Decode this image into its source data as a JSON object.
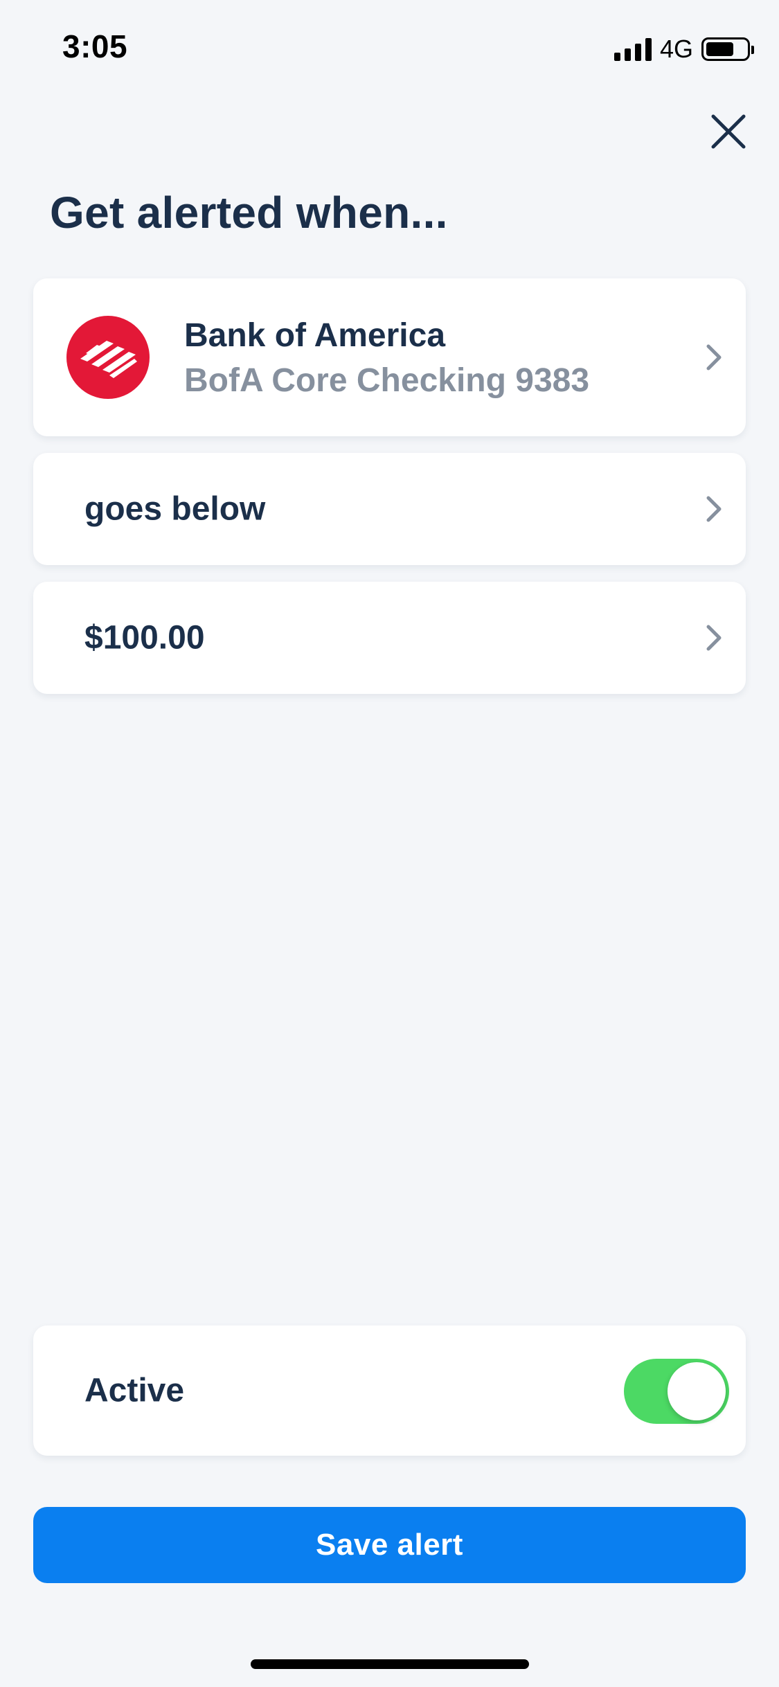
{
  "status_bar": {
    "time": "3:05",
    "network": "4G",
    "battery_level": 0.7
  },
  "header": {
    "title": "Get alerted when..."
  },
  "account": {
    "bank_name": "Bank of America",
    "account_name": "BofA Core Checking 9383",
    "logo_icon": "bank-of-america-logo",
    "logo_color": "#e31837"
  },
  "condition": {
    "label": "goes below"
  },
  "threshold": {
    "amount": "$100.00"
  },
  "active": {
    "label": "Active",
    "enabled": true,
    "toggle_color": "#4cd964"
  },
  "save": {
    "label": "Save alert",
    "color": "#0a7ff0"
  }
}
